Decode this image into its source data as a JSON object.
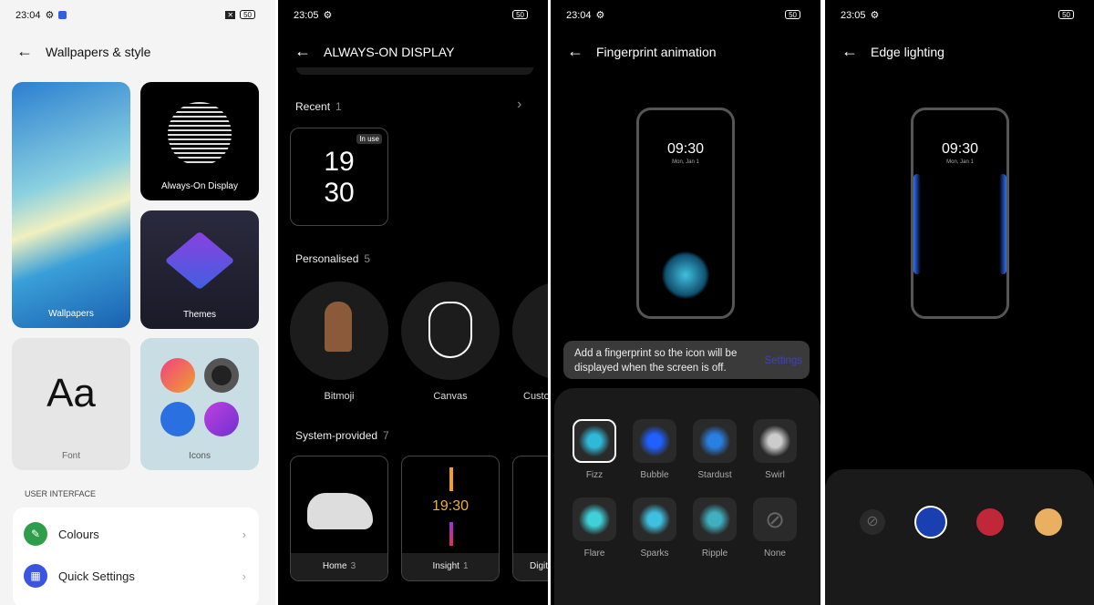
{
  "panel1": {
    "status_time": "23:04",
    "battery": "50",
    "title": "Wallpapers & style",
    "cards": {
      "wallpapers": "Wallpapers",
      "aod": "Always-On Display",
      "themes": "Themes",
      "font": "Font",
      "font_sample": "Aa",
      "icons": "Icons"
    },
    "section": "USER INTERFACE",
    "rows": [
      {
        "label": "Colours",
        "icon": "palette-icon",
        "color": "#2e9e4a"
      },
      {
        "label": "Quick Settings",
        "icon": "grid-icon",
        "color": "#3a55e0"
      }
    ]
  },
  "panel2": {
    "status_time": "23:05",
    "battery": "50",
    "title": "ALWAYS-ON DISPLAY",
    "recent": {
      "label": "Recent",
      "count": "1",
      "clock_h": "19",
      "clock_m": "30",
      "badge": "In use"
    },
    "personalised": {
      "label": "Personalised",
      "count": "5",
      "items": [
        "Bitmoji",
        "Canvas",
        "Custo"
      ]
    },
    "system": {
      "label": "System-provided",
      "count": "7",
      "items": [
        {
          "label": "Home",
          "count": "3"
        },
        {
          "label": "Insight",
          "count": "1",
          "time": "19:30"
        },
        {
          "label": "Digit",
          "count": ""
        }
      ]
    }
  },
  "panel3": {
    "status_time": "23:04",
    "battery": "50",
    "title": "Fingerprint animation",
    "clock": "09:30",
    "date": "Mon, Jan 1",
    "notice": "Add a fingerprint so the icon will be displayed when the screen is off.",
    "notice_link": "Settings",
    "animations": [
      "Fizz",
      "Bubble",
      "Stardust",
      "Swirl",
      "Flare",
      "Sparks",
      "Ripple",
      "None"
    ],
    "selected": "Fizz"
  },
  "panel4": {
    "status_time": "23:05",
    "battery": "50",
    "title": "Edge lighting",
    "clock": "09:30",
    "date": "Mon, Jan 1",
    "colors": [
      "none",
      "#1a3fb0",
      "#c0283a",
      "#e8b060"
    ],
    "selected": "#1a3fb0"
  }
}
